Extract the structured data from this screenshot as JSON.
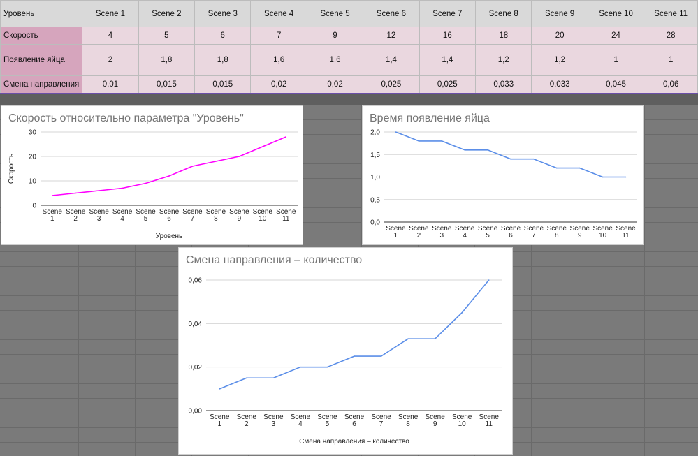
{
  "table": {
    "header_label": "Уровень",
    "columns": [
      "Scene 1",
      "Scene 2",
      "Scene 3",
      "Scene 4",
      "Scene 5",
      "Scene 6",
      "Scene 7",
      "Scene 8",
      "Scene 9",
      "Scene 10",
      "Scene 11"
    ],
    "rows": [
      {
        "label": "Скорость",
        "cells": [
          "4",
          "5",
          "6",
          "7",
          "9",
          "12",
          "16",
          "18",
          "20",
          "24",
          "28"
        ]
      },
      {
        "label": "Появление яйца",
        "cells": [
          "2",
          "1,8",
          "1,8",
          "1,6",
          "1,6",
          "1,4",
          "1,4",
          "1,2",
          "1,2",
          "1",
          "1"
        ]
      },
      {
        "label": "Смена направления",
        "cells": [
          "0,01",
          "0,015",
          "0,015",
          "0,02",
          "0,02",
          "0,025",
          "0,025",
          "0,033",
          "0,033",
          "0,045",
          "0,06"
        ]
      }
    ]
  },
  "chart_data": [
    {
      "type": "line",
      "title": "Скорость относительно параметра \"Уровень\"",
      "xlabel": "Уровень",
      "ylabel": "Скорость",
      "categories": [
        "Scene 1",
        "Scene 2",
        "Scene 3",
        "Scene 4",
        "Scene 5",
        "Scene 6",
        "Scene 7",
        "Scene 8",
        "Scene 9",
        "Scene 10",
        "Scene 11"
      ],
      "series": [
        {
          "values": [
            4,
            5,
            6,
            7,
            9,
            12,
            16,
            18,
            20,
            24,
            28
          ],
          "color": "#ff00ff"
        }
      ],
      "ylim": [
        0,
        30
      ],
      "yticks": [
        0,
        10,
        20,
        30
      ],
      "ytick_labels": [
        "0",
        "10",
        "20",
        "30"
      ],
      "grid": true
    },
    {
      "type": "line",
      "title": "Время появление яйца",
      "xlabel": "",
      "ylabel": "",
      "categories": [
        "Scene 1",
        "Scene 2",
        "Scene 3",
        "Scene 4",
        "Scene 5",
        "Scene 6",
        "Scene 7",
        "Scene 8",
        "Scene 9",
        "Scene 10",
        "Scene 11"
      ],
      "series": [
        {
          "values": [
            2,
            1.8,
            1.8,
            1.6,
            1.6,
            1.4,
            1.4,
            1.2,
            1.2,
            1,
            1
          ],
          "color": "#5b8ee8"
        }
      ],
      "ylim": [
        0,
        2
      ],
      "yticks": [
        0,
        0.5,
        1,
        1.5,
        2
      ],
      "ytick_labels": [
        "0,0",
        "0,5",
        "1,0",
        "1,5",
        "2,0"
      ],
      "grid": true
    },
    {
      "type": "line",
      "title": "Смена направления – количество",
      "xlabel": "Смена направления – количество",
      "ylabel": "",
      "categories": [
        "Scene 1",
        "Scene 2",
        "Scene 3",
        "Scene 4",
        "Scene 5",
        "Scene 6",
        "Scene 7",
        "Scene 8",
        "Scene 9",
        "Scene 10",
        "Scene 11"
      ],
      "series": [
        {
          "values": [
            0.01,
            0.015,
            0.015,
            0.02,
            0.02,
            0.025,
            0.025,
            0.033,
            0.033,
            0.045,
            0.06
          ],
          "color": "#5b8ee8"
        }
      ],
      "ylim": [
        0,
        0.06
      ],
      "yticks": [
        0,
        0.02,
        0.04,
        0.06
      ],
      "ytick_labels": [
        "0,00",
        "0,02",
        "0,04",
        "0,06"
      ],
      "grid": true
    }
  ]
}
